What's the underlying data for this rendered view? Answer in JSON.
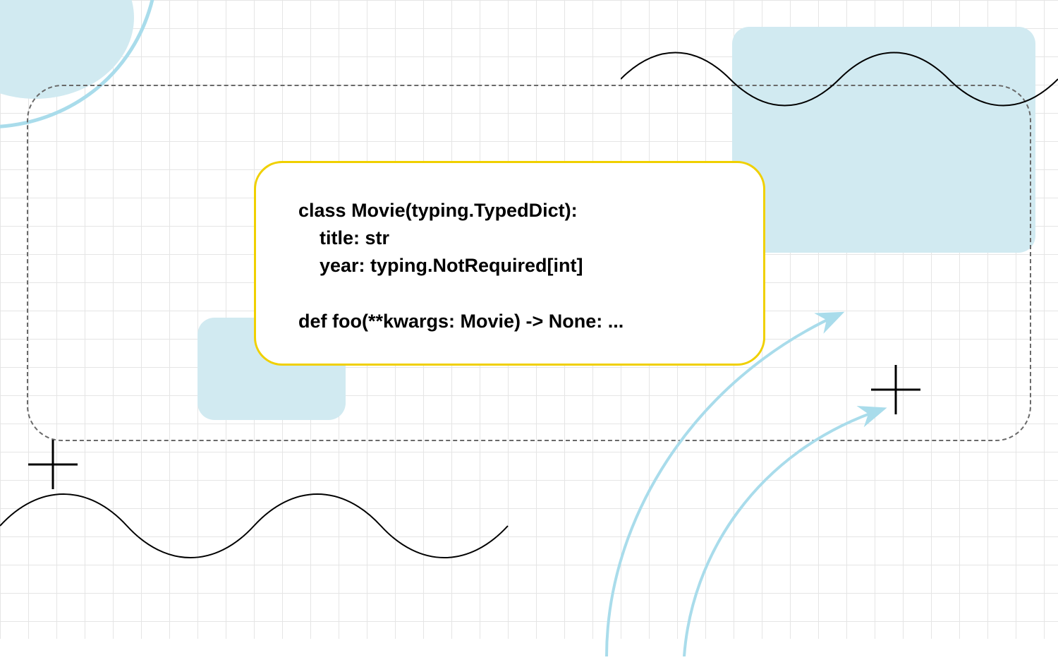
{
  "code": {
    "line1": "class Movie(typing.TypedDict):",
    "line2": "    title: str",
    "line3": "    year: typing.NotRequired[int]",
    "line4": "",
    "line5": "def foo(**kwargs: Movie) -> None: ..."
  },
  "colors": {
    "card_border": "#f0d000",
    "light_blue": "#d1eaf1",
    "accent_blue": "#a9dceb",
    "grid": "#e5e5e5"
  }
}
